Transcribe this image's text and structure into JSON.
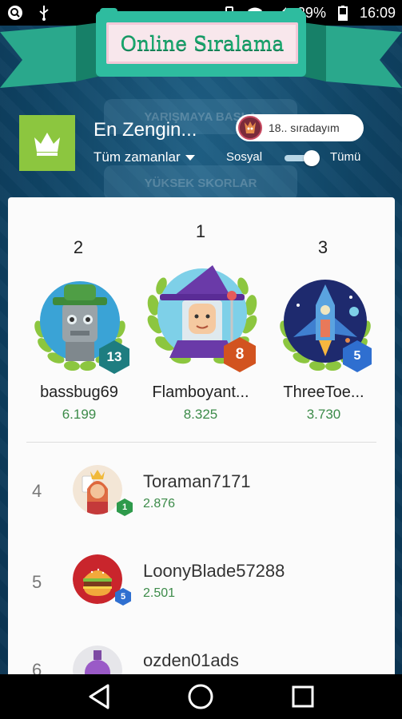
{
  "status_bar": {
    "battery": "29%",
    "time": "16:09"
  },
  "banner": {
    "title": "Online Sıralama"
  },
  "background_buttons": [
    "YARIŞMAYA BAŞLA",
    "YÜKSEK SKORLAR"
  ],
  "header": {
    "board_title": "En Zengin...",
    "rank_status": "18.. sıradayım",
    "time_filter": "Tüm zamanlar",
    "toggle_left": "Sosyal",
    "toggle_right": "Tümü",
    "toggle_on": true
  },
  "podium": [
    {
      "rank": "2",
      "name": "bassbug69",
      "score": "6.199",
      "level": "13",
      "badge_color": "#1e7d80"
    },
    {
      "rank": "1",
      "name": "Flamboyant...",
      "score": "8.325",
      "level": "8",
      "badge_color": "#d2531f"
    },
    {
      "rank": "3",
      "name": "ThreeToe...",
      "score": "3.730",
      "level": "5",
      "badge_color": "#2f6fd0"
    }
  ],
  "list": [
    {
      "rank": "4",
      "name": "Toraman7171",
      "score": "2.876",
      "level": "1",
      "badge_color": "#2e9a4b"
    },
    {
      "rank": "5",
      "name": "LoonyBlade57288",
      "score": "2.501",
      "level": "5",
      "badge_color": "#2f6fd0"
    },
    {
      "rank": "6",
      "name": "ozden01ads",
      "score": "",
      "level": "",
      "badge_color": "#2f6fd0"
    }
  ],
  "colors": {
    "accent_green": "#3c8b49",
    "banner_teal": "#2ebc9f",
    "crown_green": "#8cc63f"
  }
}
